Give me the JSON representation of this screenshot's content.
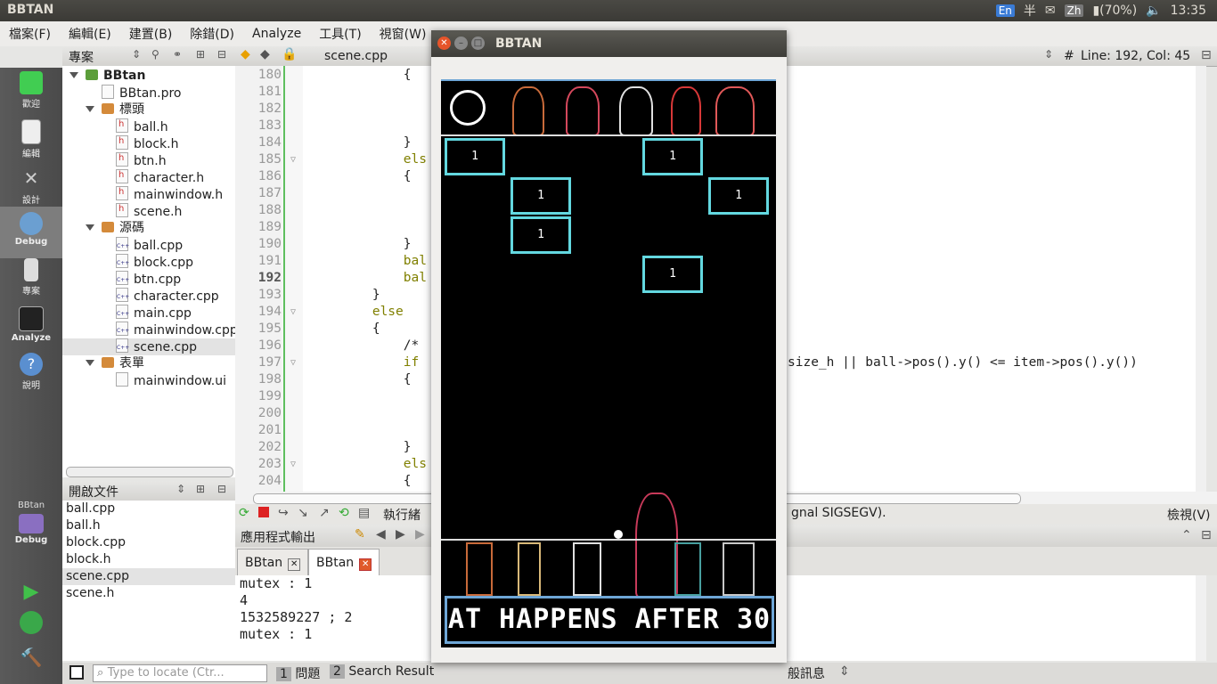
{
  "system_bar": {
    "app_title": "BBTAN",
    "input_en": "En",
    "input_half": "半",
    "input_zh": "Zh",
    "battery": "(70%)",
    "time": "13:35"
  },
  "menu": [
    "檔案(F)",
    "編輯(E)",
    "建置(B)",
    "除錯(D)",
    "Analyze",
    "工具(T)",
    "視窗(W)"
  ],
  "modes": [
    {
      "label": "歡迎"
    },
    {
      "label": "編輯"
    },
    {
      "label": "設計"
    },
    {
      "label": "Debug"
    },
    {
      "label": "專案"
    },
    {
      "label": "Analyze"
    },
    {
      "label": "說明"
    }
  ],
  "kit": {
    "name": "BBtan",
    "mode": "Debug"
  },
  "project_panel": {
    "title": "專案",
    "root": "BBtan",
    "pro_file": "BBtan.pro",
    "headers_label": "標頭",
    "headers": [
      "ball.h",
      "block.h",
      "btn.h",
      "character.h",
      "mainwindow.h",
      "scene.h"
    ],
    "sources_label": "源碼",
    "sources": [
      "ball.cpp",
      "block.cpp",
      "btn.cpp",
      "character.cpp",
      "main.cpp",
      "mainwindow.cpp",
      "scene.cpp"
    ],
    "forms_label": "表單",
    "forms": [
      "mainwindow.ui"
    ]
  },
  "open_docs": {
    "title": "開啟文件",
    "files": [
      "ball.cpp",
      "ball.h",
      "block.cpp",
      "block.h",
      "scene.cpp",
      "scene.h"
    ]
  },
  "editor": {
    "file": "scene.cpp",
    "position": "Line: 192, Col: 45",
    "lines": [
      {
        "n": "180",
        "text": "            {"
      },
      {
        "n": "181",
        "text": ""
      },
      {
        "n": "182",
        "text": ""
      },
      {
        "n": "183",
        "text": ""
      },
      {
        "n": "184",
        "text": "            }"
      },
      {
        "n": "185",
        "text": "            els"
      },
      {
        "n": "186",
        "text": "            {"
      },
      {
        "n": "187",
        "text": ""
      },
      {
        "n": "188",
        "text": ""
      },
      {
        "n": "189",
        "text": ""
      },
      {
        "n": "190",
        "text": "            }"
      },
      {
        "n": "191",
        "text": "            bal"
      },
      {
        "n": "192",
        "text": "            bal"
      },
      {
        "n": "193",
        "text": "        }"
      },
      {
        "n": "194",
        "text": "        else"
      },
      {
        "n": "195",
        "text": "        {"
      },
      {
        "n": "196",
        "text": "            /*"
      },
      {
        "n": "197",
        "text": "            if"
      },
      {
        "n": "198",
        "text": "            {"
      },
      {
        "n": "199",
        "text": ""
      },
      {
        "n": "200",
        "text": ""
      },
      {
        "n": "201",
        "text": ""
      },
      {
        "n": "202",
        "text": "            }"
      },
      {
        "n": "203",
        "text": "            els"
      },
      {
        "n": "204",
        "text": "            {"
      }
    ],
    "line197_tail": "size_h || ball->pos().y() <= item->pos().y())"
  },
  "run_bar": {
    "thread_label": "執行緒",
    "signal_text": "gnal SIGSEGV).",
    "view_label": "檢視(V)"
  },
  "output": {
    "title": "應用程式輸出",
    "tabs": [
      "BBtan",
      "BBtan"
    ],
    "lines": [
      "mutex : 1",
      "4",
      "1532589227 ; 2",
      "mutex : 1"
    ]
  },
  "status_bar": {
    "locate_placeholder": "Type to locate (Ctr...",
    "items": [
      {
        "n": "1",
        "label": "問題"
      },
      {
        "n": "2",
        "label": "Search Result"
      }
    ],
    "right_label": "般訊息"
  },
  "game": {
    "title": "BBTAN",
    "blocks": [
      "1",
      "1",
      "1",
      "1",
      "1",
      "1"
    ],
    "banner": "AT HAPPENS AFTER 30"
  }
}
